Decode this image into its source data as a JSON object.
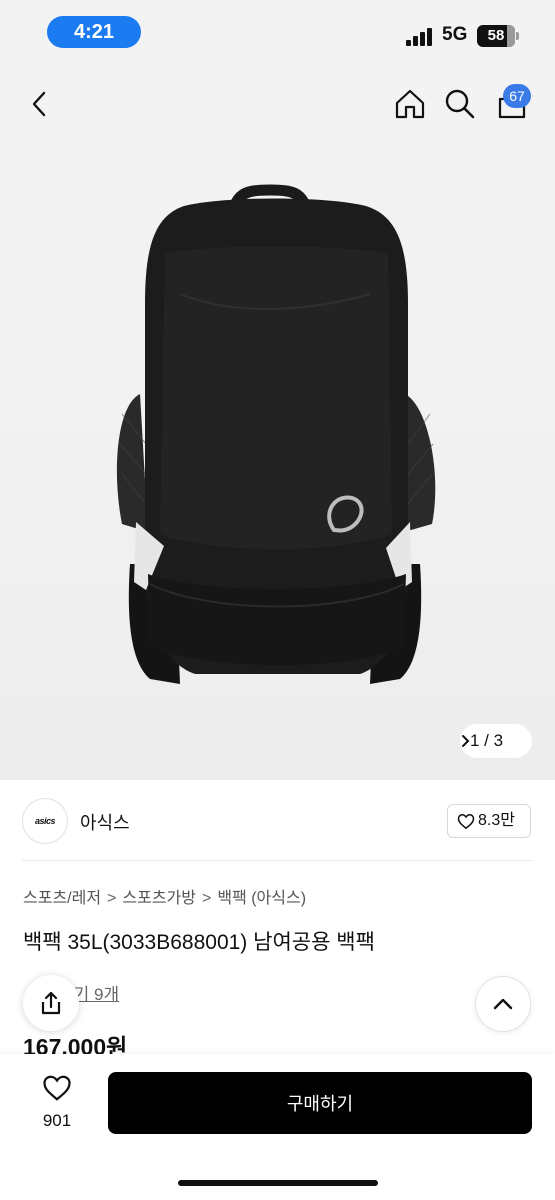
{
  "status_bar": {
    "time": "4:21",
    "network": "5G",
    "battery": "58"
  },
  "header": {
    "cart_count": "67"
  },
  "gallery": {
    "pager": "1 / 3"
  },
  "brand": {
    "logo_text": "asics",
    "name": "아식스",
    "likes": "8.3만"
  },
  "breadcrumb": [
    "스포츠/레저",
    "스포츠가방",
    "백팩 (아식스)"
  ],
  "product": {
    "title": "백팩 35L(3033B688001) 남여공용 백팩",
    "reviews": "후기 9개",
    "price": "167,000원"
  },
  "bottom_bar": {
    "wish_count": "901",
    "buy_label": "구매하기"
  },
  "colors": {
    "accent": "#1a7cf0",
    "badge": "#3b7be8",
    "buy_button": "#000000"
  },
  "icons": [
    "back-icon",
    "home-icon",
    "search-icon",
    "bag-icon",
    "heart-icon",
    "share-icon",
    "chevron-up-icon",
    "chevron-right-icon"
  ]
}
